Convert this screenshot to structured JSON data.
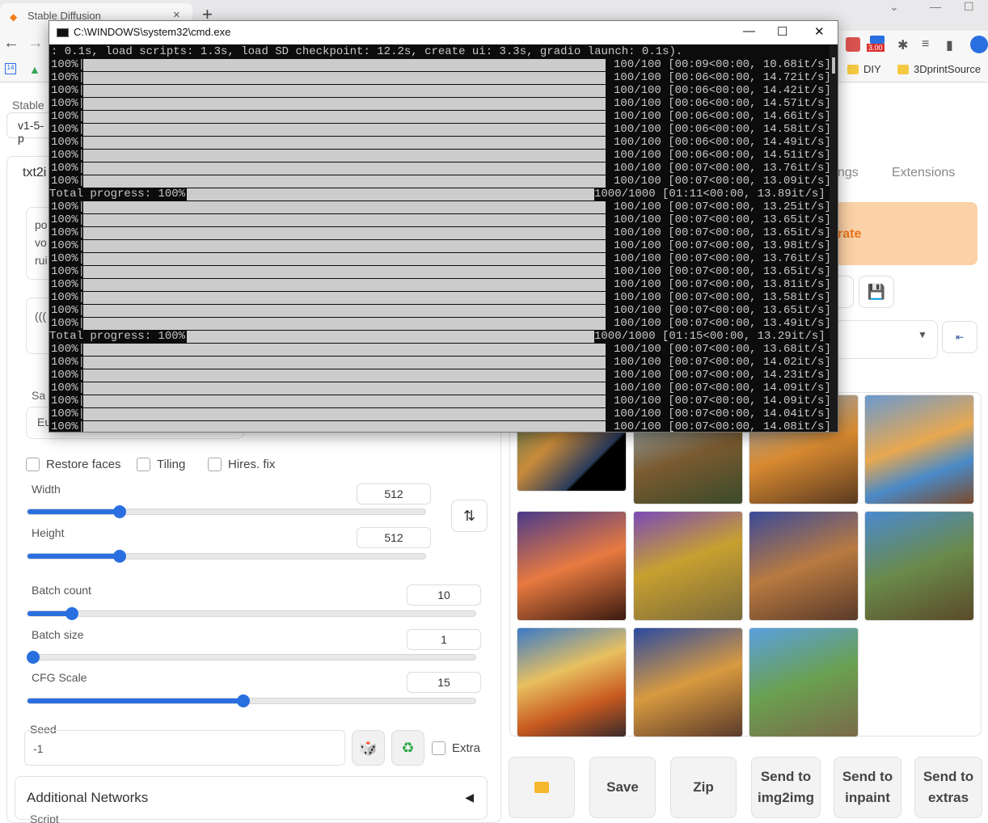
{
  "browser": {
    "tab_title": "Stable Diffusion",
    "bookmarks": [
      "DIY",
      "3DprintSource"
    ],
    "badge": "3.00"
  },
  "page": {
    "checkpoint_label": "Stable",
    "checkpoint_value": "v1-5-p",
    "tab_txt2img": "txt2i",
    "prompt_lines": [
      "po",
      "vo",
      "rui"
    ],
    "neg_prompt": "(((",
    "sampler_label": "Sa",
    "sampler_value": "Eu",
    "restore_faces": "Restore faces",
    "tiling": "Tiling",
    "hires_fix": "Hires. fix",
    "width_label": "Width",
    "width_value": "512",
    "height_label": "Height",
    "height_value": "512",
    "batch_count_label": "Batch count",
    "batch_count_value": "10",
    "batch_size_label": "Batch size",
    "batch_size_value": "1",
    "cfg_label": "CFG Scale",
    "cfg_value": "15",
    "seed_label": "Seed",
    "seed_value": "-1",
    "extra_label": "Extra",
    "additional_networks": "Additional Networks",
    "script_label": "Script",
    "tab_settings_fragment": "ngs",
    "tab_extensions": "Extensions",
    "generate_fragment": "rate",
    "actions": {
      "save": "Save",
      "zip": "Zip",
      "send_img2img_1": "Send to",
      "send_img2img_2": "img2img",
      "send_inpaint_1": "Send to",
      "send_inpaint_2": "inpaint",
      "send_extras_1": "Send to",
      "send_extras_2": "extras"
    }
  },
  "cmd": {
    "title": "C:\\WINDOWS\\system32\\cmd.exe",
    "header_line": ": 0.1s, load scripts: 1.3s, load SD checkpoint: 12.2s, create ui: 3.3s, gradio launch: 0.1s).",
    "lines": [
      {
        "pct": "100%|",
        "stat": "100/100 [00:09<00:00, 10.68it/s]"
      },
      {
        "pct": "100%|",
        "stat": "100/100 [00:06<00:00, 14.72it/s]"
      },
      {
        "pct": "100%|",
        "stat": "100/100 [00:06<00:00, 14.42it/s]"
      },
      {
        "pct": "100%|",
        "stat": "100/100 [00:06<00:00, 14.57it/s]"
      },
      {
        "pct": "100%|",
        "stat": "100/100 [00:06<00:00, 14.66it/s]"
      },
      {
        "pct": "100%|",
        "stat": "100/100 [00:06<00:00, 14.58it/s]"
      },
      {
        "pct": "100%|",
        "stat": "100/100 [00:06<00:00, 14.49it/s]"
      },
      {
        "pct": "100%|",
        "stat": "100/100 [00:06<00:00, 14.51it/s]"
      },
      {
        "pct": "100%|",
        "stat": "100/100 [00:07<00:00, 13.76it/s]"
      },
      {
        "pct": "100%|",
        "stat": "100/100 [00:07<00:00, 13.09it/s]"
      },
      {
        "pct": "Total progress: 100%|",
        "stat": "1000/1000 [01:11<00:00, 13.89it/s]",
        "total": true
      },
      {
        "pct": "100%|",
        "stat": "100/100 [00:07<00:00, 13.25it/s]"
      },
      {
        "pct": "100%|",
        "stat": "100/100 [00:07<00:00, 13.65it/s]"
      },
      {
        "pct": "100%|",
        "stat": "100/100 [00:07<00:00, 13.65it/s]"
      },
      {
        "pct": "100%|",
        "stat": "100/100 [00:07<00:00, 13.98it/s]"
      },
      {
        "pct": "100%|",
        "stat": "100/100 [00:07<00:00, 13.76it/s]"
      },
      {
        "pct": "100%|",
        "stat": "100/100 [00:07<00:00, 13.65it/s]"
      },
      {
        "pct": "100%|",
        "stat": "100/100 [00:07<00:00, 13.81it/s]"
      },
      {
        "pct": "100%|",
        "stat": "100/100 [00:07<00:00, 13.58it/s]"
      },
      {
        "pct": "100%|",
        "stat": "100/100 [00:07<00:00, 13.65it/s]"
      },
      {
        "pct": "100%|",
        "stat": "100/100 [00:07<00:00, 13.49it/s]"
      },
      {
        "pct": "Total progress: 100%|",
        "stat": "1000/1000 [01:15<00:00, 13.29it/s]",
        "total": true
      },
      {
        "pct": "100%|",
        "stat": "100/100 [00:07<00:00, 13.68it/s]"
      },
      {
        "pct": "100%|",
        "stat": "100/100 [00:07<00:00, 14.02it/s]"
      },
      {
        "pct": "100%|",
        "stat": "100/100 [00:07<00:00, 14.23it/s]"
      },
      {
        "pct": "100%|",
        "stat": "100/100 [00:07<00:00, 14.09it/s]"
      },
      {
        "pct": "100%|",
        "stat": "100/100 [00:07<00:00, 14.09it/s]"
      },
      {
        "pct": "100%|",
        "stat": "100/100 [00:07<00:00, 14.04it/s]"
      },
      {
        "pct": "100%|",
        "stat": "100/100 [00:07<00:00, 14.08it/s]"
      }
    ]
  },
  "colors": {
    "accent": "#2a6fe0",
    "generate": "#fbd1a7",
    "generate_text": "#e8731a"
  }
}
